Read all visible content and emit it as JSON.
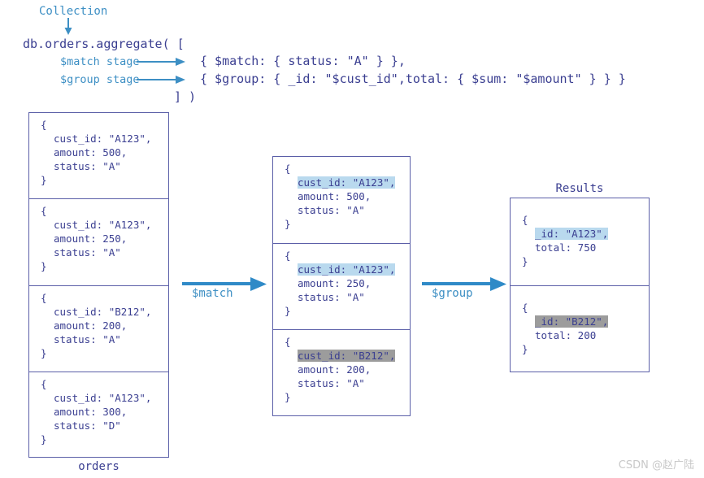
{
  "diagram": {
    "title_labels": {
      "collection": "Collection",
      "match_stage": "$match stage",
      "group_stage": "$group stage"
    },
    "code": {
      "line1": "db.orders.aggregate( [",
      "line2": "{ $match: { status: \"A\" } },",
      "line3": "{ $group: { _id: \"$cust_id\",total: { $sum: \"$amount\" } } }",
      "line4": "] )"
    },
    "arrows": {
      "match_label": "$match",
      "group_label": "$group"
    },
    "captions": {
      "orders": "orders",
      "results": "Results"
    },
    "source_collection": {
      "name": "orders",
      "documents": [
        {
          "open": "{",
          "cust_id": "cust_id: \"A123\",",
          "amount": "amount: 500,",
          "status": "status: \"A\"",
          "close": "}"
        },
        {
          "open": "{",
          "cust_id": "cust_id: \"A123\",",
          "amount": "amount: 250,",
          "status": "status: \"A\"",
          "close": "}"
        },
        {
          "open": "{",
          "cust_id": "cust_id: \"B212\",",
          "amount": "amount: 200,",
          "status": "status: \"A\"",
          "close": "}"
        },
        {
          "open": "{",
          "cust_id": "cust_id: \"A123\",",
          "amount": "amount: 300,",
          "status": "status: \"D\"",
          "close": "}"
        }
      ]
    },
    "matched_documents": {
      "documents": [
        {
          "open": "{",
          "cust_id": "cust_id: \"A123\",",
          "highlight": "blue",
          "amount": "amount: 500,",
          "status": "status: \"A\"",
          "close": "}"
        },
        {
          "open": "{",
          "cust_id": "cust_id: \"A123\",",
          "highlight": "blue",
          "amount": "amount: 250,",
          "status": "status: \"A\"",
          "close": "}"
        },
        {
          "open": "{",
          "cust_id": "cust_id: \"B212\",",
          "highlight": "gray",
          "amount": "amount: 200,",
          "status": "status: \"A\"",
          "close": "}"
        }
      ]
    },
    "results": {
      "title": "Results",
      "documents": [
        {
          "open": "{",
          "id": "_id: \"A123\",",
          "highlight": "blue",
          "total": "total: 750",
          "close": "}"
        },
        {
          "open": "{",
          "id": "_id: \"B212\",",
          "highlight": "gray",
          "total": "total: 200",
          "close": "}"
        }
      ]
    },
    "colors": {
      "code_navy": "#3b3f91",
      "accent_blue": "#3d8fc4",
      "border_navy": "#5b5fa8",
      "highlight_blue": "#b9d9ee",
      "highlight_gray": "#9c9c9c",
      "watermark_gray": "#c8c8c8"
    },
    "watermark": "CSDN @赵广陆"
  }
}
